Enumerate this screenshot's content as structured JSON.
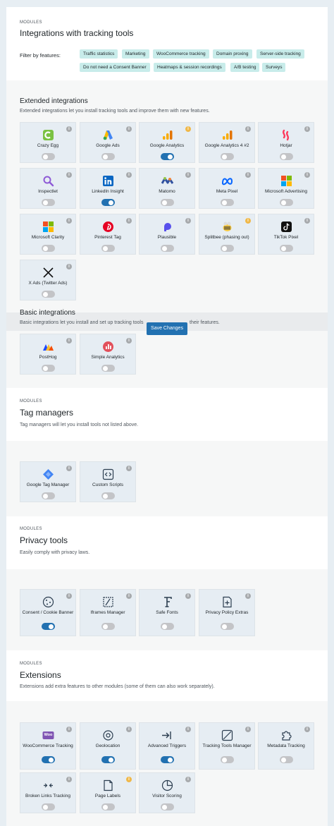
{
  "header": {
    "eyebrow": "MODULES",
    "title": "Integrations with tracking tools",
    "filter_label": "Filter by features:",
    "filters": [
      "Traffic statistics",
      "Marketing",
      "WooCommerce tracking",
      "Domain proxing",
      "Server-side tracking",
      "Do not need a Consent Banner",
      "Heatmaps & session recordings",
      "A/B testing",
      "Surveys"
    ]
  },
  "extended": {
    "title": "Extended integrations",
    "desc": "Extended integrations let you install tracking tools and improve them with new features.",
    "cards": [
      {
        "name": "Crazy Egg",
        "on": false,
        "icon": "crazy-egg-icon"
      },
      {
        "name": "Google Ads",
        "on": false,
        "icon": "google-ads-icon"
      },
      {
        "name": "Google Analytics",
        "on": true,
        "icon": "google-analytics-icon",
        "warn": true
      },
      {
        "name": "Google Analytics 4 #2",
        "on": false,
        "icon": "google-analytics-icon"
      },
      {
        "name": "Hotjar",
        "on": false,
        "icon": "hotjar-icon"
      },
      {
        "name": "Inspectlet",
        "on": false,
        "icon": "inspectlet-icon"
      },
      {
        "name": "LinkedIn Insight",
        "on": true,
        "icon": "linkedin-icon"
      },
      {
        "name": "Matomo",
        "on": false,
        "icon": "matomo-icon"
      },
      {
        "name": "Meta Pixel",
        "on": false,
        "icon": "meta-icon"
      },
      {
        "name": "Microsoft Advertising",
        "on": false,
        "icon": "microsoft-icon"
      },
      {
        "name": "Microsoft Clarity",
        "on": false,
        "icon": "microsoft-icon"
      },
      {
        "name": "Pinterest Tag",
        "on": false,
        "icon": "pinterest-icon"
      },
      {
        "name": "Plausible",
        "on": false,
        "icon": "plausible-icon"
      },
      {
        "name": "Splitbee (phasing out)",
        "on": false,
        "icon": "splitbee-icon",
        "warn": true
      },
      {
        "name": "TikTok Pixel",
        "on": false,
        "icon": "tiktok-icon"
      },
      {
        "name": "X Ads (Twitter Ads)",
        "on": false,
        "icon": "x-icon"
      }
    ]
  },
  "basic": {
    "title": "Basic integrations",
    "desc_a": "Basic integrations let you install and set up tracking tools",
    "desc_b": "their features.",
    "save_label": "Save Changes",
    "cards": [
      {
        "name": "PostHog",
        "on": false,
        "icon": "posthog-icon"
      },
      {
        "name": "Simple Analytics",
        "on": false,
        "icon": "simple-analytics-icon"
      }
    ]
  },
  "tag_managers": {
    "eyebrow": "MODULES",
    "title": "Tag managers",
    "desc": "Tag managers will let you install tools not listed above.",
    "cards": [
      {
        "name": "Google Tag Manager",
        "on": false,
        "icon": "gtm-icon"
      },
      {
        "name": "Custom Scripts",
        "on": false,
        "icon": "code-icon"
      }
    ]
  },
  "privacy": {
    "eyebrow": "MODULES",
    "title": "Privacy tools",
    "desc": "Easily comply with privacy laws.",
    "cards": [
      {
        "name": "Consent / Cookie Banner",
        "on": true,
        "icon": "cookie-icon"
      },
      {
        "name": "Iframes Manager",
        "on": false,
        "icon": "iframe-icon"
      },
      {
        "name": "Safe Fonts",
        "on": false,
        "icon": "font-icon"
      },
      {
        "name": "Privacy Policy Extras",
        "on": false,
        "icon": "document-plus-icon"
      }
    ]
  },
  "extensions": {
    "eyebrow": "MODULES",
    "title": "Extensions",
    "desc": "Extensions add extra features to other modules (some of them can also work separately).",
    "cards": [
      {
        "name": "WooCommerce Tracking",
        "on": true,
        "icon": "woo-icon"
      },
      {
        "name": "Geolocation",
        "on": true,
        "icon": "geolocation-icon"
      },
      {
        "name": "Advanced Triggers",
        "on": true,
        "icon": "triggers-icon"
      },
      {
        "name": "Tracking Tools Manager",
        "on": false,
        "icon": "code-off-icon"
      },
      {
        "name": "Metadata Tracking",
        "on": false,
        "icon": "puzzle-icon"
      },
      {
        "name": "Broken Links Tracking",
        "on": false,
        "icon": "broken-link-icon"
      },
      {
        "name": "Page Labels",
        "on": false,
        "icon": "page-icon",
        "warn": true
      },
      {
        "name": "Visitor Scoring",
        "on": false,
        "icon": "pie-icon"
      }
    ]
  },
  "info_glyph": "i",
  "woo_text": "Woo",
  "colors": {
    "accent": "#2271b1",
    "chip": "#c8ecea",
    "card": "#e6edf3"
  }
}
